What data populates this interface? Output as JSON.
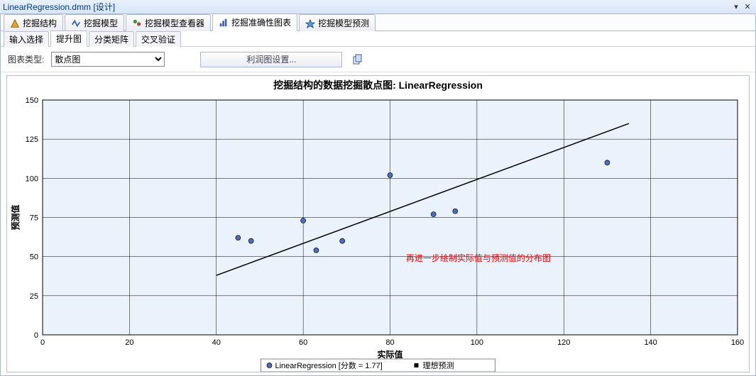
{
  "window": {
    "title": "LinearRegression.dmm [设计]",
    "min_glyph": "▾",
    "close_glyph": "✕"
  },
  "main_tabs": [
    {
      "label": "挖掘结构"
    },
    {
      "label": "挖掘模型"
    },
    {
      "label": "挖掘模型查看器"
    },
    {
      "label": "挖掘准确性图表",
      "active": true
    },
    {
      "label": "挖掘模型预测"
    }
  ],
  "sub_tabs": [
    {
      "label": "输入选择"
    },
    {
      "label": "提升图",
      "active": true
    },
    {
      "label": "分类矩阵"
    },
    {
      "label": "交叉验证"
    }
  ],
  "toolbar": {
    "chart_type_label": "图表类型:",
    "chart_type_value": "散点图",
    "profit_button": "利润图设置...",
    "copy_tooltip": "复制"
  },
  "annotation": "再进一步绘制实际值与预测值的分布图",
  "chart_data": {
    "type": "scatter",
    "title": "挖掘结构的数据挖掘散点图: LinearRegression",
    "xlabel": "实际值",
    "ylabel": "预测值",
    "x_ticks": [
      0,
      20,
      40,
      60,
      80,
      100,
      120,
      140,
      160
    ],
    "y_ticks": [
      0,
      25,
      50,
      75,
      100,
      125,
      150
    ],
    "xlim": [
      0,
      160
    ],
    "ylim": [
      0,
      150
    ],
    "series": [
      {
        "name": "LinearRegression [分数 = 1.77]",
        "kind": "points",
        "marker": "circle",
        "color": "#4a6ec8",
        "points": [
          {
            "x": 45,
            "y": 62
          },
          {
            "x": 48,
            "y": 60
          },
          {
            "x": 60,
            "y": 73
          },
          {
            "x": 63,
            "y": 54
          },
          {
            "x": 69,
            "y": 60
          },
          {
            "x": 80,
            "y": 102
          },
          {
            "x": 90,
            "y": 77
          },
          {
            "x": 95,
            "y": 79
          },
          {
            "x": 130,
            "y": 110
          }
        ]
      },
      {
        "name": "理想预测",
        "kind": "line",
        "color": "#000000",
        "line": [
          {
            "x": 40,
            "y": 38
          },
          {
            "x": 135,
            "y": 135
          }
        ]
      }
    ],
    "legend_items": [
      {
        "marker": "circle",
        "color": "#4a6ec8",
        "label": "LinearRegression [分数 = 1.77]"
      },
      {
        "marker": "square",
        "color": "#000000",
        "label": "理想预测"
      }
    ]
  }
}
